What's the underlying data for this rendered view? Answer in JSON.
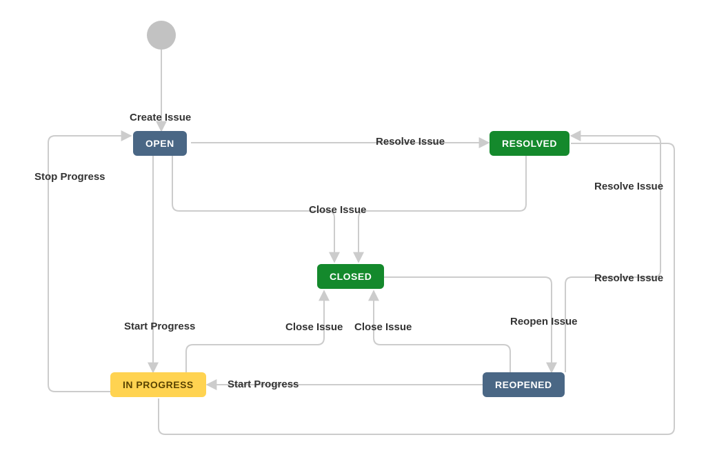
{
  "states": {
    "open": {
      "label": "OPEN"
    },
    "resolved": {
      "label": "RESOLVED"
    },
    "closed": {
      "label": "CLOSED"
    },
    "inprogress": {
      "label": "IN PROGRESS"
    },
    "reopened": {
      "label": "REOPENED"
    }
  },
  "transitions": {
    "create_issue": "Create Issue",
    "resolve_issue": "Resolve Issue",
    "close_issue": "Close Issue",
    "start_progress": "Start Progress",
    "stop_progress": "Stop Progress",
    "reopen_issue": "Reopen Issue"
  },
  "colors": {
    "edge": "#cccccc",
    "text": "#333333",
    "blue": "#4a6785",
    "green": "#14892c",
    "yellow": "#ffd351"
  }
}
